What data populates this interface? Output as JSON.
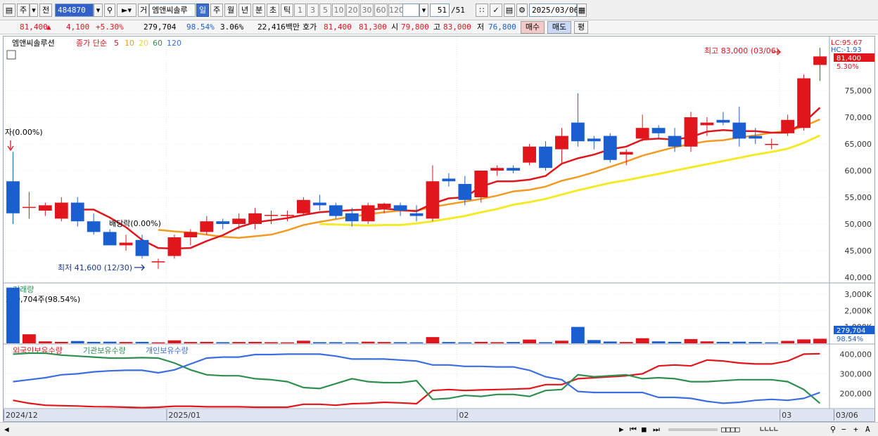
{
  "toolbar": {
    "period_main": "주",
    "prev_label": "전",
    "code": "484870",
    "stock_name": "엠앤씨솔루",
    "periods": [
      "일",
      "주",
      "월",
      "년",
      "분",
      "초",
      "틱"
    ],
    "active_period": "일",
    "steps": [
      "1",
      "3",
      "5",
      "10",
      "20",
      "30",
      "60",
      "120"
    ],
    "count": "51",
    "count_total": "/51",
    "date": "2025/03/06",
    "trade_label": "거"
  },
  "quote": {
    "price": "81,400",
    "arrow": "▲",
    "change": "4,100",
    "change_pct": "+5.30%",
    "volume": "279,704",
    "volume_pct": "98.54%",
    "turnover_pct": "3.06%",
    "amount": "22,416백만",
    "ask_label": "호가",
    "ask": "81,400",
    "bid": "81,300",
    "open_label": "시",
    "open": "79,800",
    "high_label": "고",
    "high": "83,000",
    "low_label": "저",
    "low": "76,800",
    "buy_button": "매수",
    "sell_button": "매도",
    "eval_button": "평"
  },
  "legend": {
    "name": "엠앤씨솔루션",
    "price_label": "종가 단순",
    "ma5": "5",
    "ma10": "10",
    "ma20": "20",
    "ma60": "60",
    "ma120": "120"
  },
  "annotations": {
    "high_note": "최고 83,000 (03/06)",
    "low_note": "최저 41,600 (12/30)",
    "ex_rights": "자(0.00%)",
    "ex_dividend": "배당락(0.00%)",
    "lc_label": "LC:95.67",
    "hc_label": "HC:-1.93",
    "last_price": "81,400",
    "last_pct": "5.30%",
    "volume_title": "거래량",
    "volume_note": "279,704주(98.54%)",
    "volume_last": "279,704",
    "volume_last_pct": "98.54%",
    "holdings_foreign": "외국인보유수량",
    "holdings_inst": "기관보유수량",
    "holdings_indiv": "개인보유수량"
  },
  "axes": {
    "price_ticks": [
      "75,000",
      "70,000",
      "65,000",
      "60,000",
      "55,000",
      "50,000",
      "45,000",
      "40,000"
    ],
    "volume_ticks": [
      "3,000K",
      "2,000K",
      "1,000K"
    ],
    "holdings_ticks": [
      "400,000",
      "300,000",
      "200,000"
    ],
    "x_labels": [
      "2024/12",
      "2025/01",
      "02",
      "03",
      "03/06"
    ]
  },
  "colors": {
    "up": "#e0161c",
    "down": "#1a5fd0",
    "ma5": "#e0161c",
    "ma10": "#f29b22",
    "ma20": "#f4ea2a",
    "foreign_line": "#e0161c",
    "inst_line": "#2f8f4f",
    "indiv_line": "#3b6ee0"
  },
  "chart_data": [
    {
      "type": "candlestick",
      "title": "엠앤씨솔루션",
      "ylim": [
        40000,
        83000
      ],
      "candles": [
        {
          "o": 58000,
          "h": 63500,
          "l": 50000,
          "c": 52000
        },
        {
          "o": 53000,
          "h": 56000,
          "l": 51000,
          "c": 53200
        },
        {
          "o": 52500,
          "h": 54000,
          "l": 51500,
          "c": 53500
        },
        {
          "o": 51000,
          "h": 55000,
          "l": 50500,
          "c": 54000
        },
        {
          "o": 54000,
          "h": 55000,
          "l": 49500,
          "c": 50500
        },
        {
          "o": 50500,
          "h": 52000,
          "l": 48000,
          "c": 48500
        },
        {
          "o": 48500,
          "h": 49000,
          "l": 46000,
          "c": 46000
        },
        {
          "o": 46000,
          "h": 48000,
          "l": 45000,
          "c": 46500
        },
        {
          "o": 47000,
          "h": 48000,
          "l": 43500,
          "c": 44000
        },
        {
          "o": 42800,
          "h": 43500,
          "l": 41600,
          "c": 43000
        },
        {
          "o": 44000,
          "h": 48000,
          "l": 43500,
          "c": 47500
        },
        {
          "o": 47500,
          "h": 49000,
          "l": 46000,
          "c": 48500
        },
        {
          "o": 48500,
          "h": 51500,
          "l": 48000,
          "c": 50500
        },
        {
          "o": 50500,
          "h": 51000,
          "l": 49000,
          "c": 50000
        },
        {
          "o": 50000,
          "h": 52000,
          "l": 49000,
          "c": 51000
        },
        {
          "o": 50000,
          "h": 53000,
          "l": 49000,
          "c": 52000
        },
        {
          "o": 51500,
          "h": 52500,
          "l": 50000,
          "c": 51700
        },
        {
          "o": 51500,
          "h": 52500,
          "l": 50500,
          "c": 51700
        },
        {
          "o": 52000,
          "h": 55000,
          "l": 51500,
          "c": 54500
        },
        {
          "o": 54000,
          "h": 55500,
          "l": 52500,
          "c": 53500
        },
        {
          "o": 53500,
          "h": 54000,
          "l": 51000,
          "c": 51500
        },
        {
          "o": 52000,
          "h": 53000,
          "l": 49500,
          "c": 50500
        },
        {
          "o": 50500,
          "h": 54000,
          "l": 50000,
          "c": 53500
        },
        {
          "o": 53000,
          "h": 54000,
          "l": 52000,
          "c": 53800
        },
        {
          "o": 53500,
          "h": 54000,
          "l": 51500,
          "c": 52500
        },
        {
          "o": 52000,
          "h": 53500,
          "l": 50500,
          "c": 51500
        },
        {
          "o": 51000,
          "h": 61000,
          "l": 50500,
          "c": 58000
        },
        {
          "o": 58500,
          "h": 59500,
          "l": 57000,
          "c": 58000
        },
        {
          "o": 57500,
          "h": 59000,
          "l": 53500,
          "c": 54500
        },
        {
          "o": 55000,
          "h": 60000,
          "l": 54000,
          "c": 60000
        },
        {
          "o": 60000,
          "h": 61000,
          "l": 59000,
          "c": 60500
        },
        {
          "o": 60500,
          "h": 61000,
          "l": 59500,
          "c": 60000
        },
        {
          "o": 61500,
          "h": 65000,
          "l": 61000,
          "c": 64500
        },
        {
          "o": 64500,
          "h": 65500,
          "l": 60000,
          "c": 60500
        },
        {
          "o": 64000,
          "h": 68000,
          "l": 61500,
          "c": 66500
        },
        {
          "o": 69000,
          "h": 74500,
          "l": 64500,
          "c": 65500
        },
        {
          "o": 66000,
          "h": 66500,
          "l": 64000,
          "c": 65500
        },
        {
          "o": 66500,
          "h": 67000,
          "l": 61500,
          "c": 62000
        },
        {
          "o": 63000,
          "h": 64000,
          "l": 61000,
          "c": 63500
        },
        {
          "o": 66000,
          "h": 70500,
          "l": 65500,
          "c": 68000
        },
        {
          "o": 68000,
          "h": 68500,
          "l": 66000,
          "c": 67000
        },
        {
          "o": 66500,
          "h": 68000,
          "l": 63500,
          "c": 64500
        },
        {
          "o": 64500,
          "h": 71000,
          "l": 63500,
          "c": 70000
        },
        {
          "o": 68500,
          "h": 70000,
          "l": 66500,
          "c": 69000
        },
        {
          "o": 69500,
          "h": 71000,
          "l": 68500,
          "c": 69000
        },
        {
          "o": 69000,
          "h": 72000,
          "l": 64500,
          "c": 66000
        },
        {
          "o": 66500,
          "h": 68000,
          "l": 65000,
          "c": 66000
        },
        {
          "o": 65000,
          "h": 66000,
          "l": 64000,
          "c": 65000
        },
        {
          "o": 67000,
          "h": 70500,
          "l": 66500,
          "c": 69500
        },
        {
          "o": 68000,
          "h": 78000,
          "l": 67500,
          "c": 77300
        },
        {
          "o": 79800,
          "h": 83000,
          "l": 76800,
          "c": 81400
        }
      ],
      "ma5": [
        null,
        null,
        null,
        null,
        52700,
        52700,
        51200,
        49400,
        47000,
        45500,
        45400,
        45500,
        46800,
        47900,
        49400,
        50300,
        50700,
        51100,
        51700,
        52200,
        52400,
        52600,
        52700,
        52900,
        52600,
        52400,
        53800,
        54800,
        55000,
        57000,
        58000,
        58000,
        58300,
        59000,
        61300,
        62300,
        63000,
        64000,
        64500,
        65800,
        66000,
        65800,
        66300,
        67300,
        67600,
        67400,
        67400,
        67100,
        67100,
        69000,
        71800
      ],
      "ma10": [
        null,
        null,
        null,
        null,
        null,
        null,
        null,
        null,
        null,
        48900,
        48600,
        48400,
        48000,
        47600,
        47400,
        47700,
        48000,
        48800,
        49800,
        50400,
        50900,
        51400,
        51800,
        52200,
        52500,
        52500,
        53200,
        53700,
        54200,
        54700,
        55300,
        56100,
        56400,
        57000,
        58100,
        58800,
        59700,
        60700,
        61700,
        62800,
        63600,
        64400,
        65000,
        65500,
        65700,
        66200,
        66600,
        67100,
        67400,
        68300,
        69600
      ],
      "ma20": [
        null,
        null,
        null,
        null,
        null,
        null,
        null,
        null,
        null,
        null,
        null,
        null,
        null,
        null,
        null,
        null,
        null,
        null,
        null,
        50000,
        49900,
        49800,
        49700,
        49800,
        49800,
        50100,
        50500,
        51000,
        51500,
        52200,
        52800,
        53600,
        54100,
        54700,
        55500,
        56300,
        57000,
        57700,
        58200,
        58800,
        59400,
        60000,
        60600,
        61200,
        61800,
        62400,
        63000,
        63500,
        64100,
        65200,
        66600
      ]
    },
    {
      "type": "bar",
      "title": "거래량",
      "values": [
        3400000,
        550000,
        120000,
        90000,
        140000,
        90000,
        100000,
        80000,
        90000,
        60000,
        180000,
        80000,
        90000,
        70000,
        80000,
        90000,
        70000,
        60000,
        160000,
        70000,
        70000,
        60000,
        100000,
        80000,
        70000,
        60000,
        380000,
        80000,
        60000,
        90000,
        70000,
        80000,
        230000,
        70000,
        160000,
        1000000,
        200000,
        110000,
        80000,
        310000,
        120000,
        90000,
        260000,
        120000,
        90000,
        100000,
        80000,
        60000,
        150000,
        240000,
        279704
      ],
      "up_days": [
        false,
        true,
        true,
        true,
        false,
        false,
        false,
        true,
        false,
        true,
        true,
        true,
        true,
        false,
        true,
        true,
        true,
        true,
        true,
        false,
        false,
        false,
        true,
        true,
        false,
        false,
        true,
        false,
        false,
        true,
        true,
        false,
        true,
        false,
        true,
        false,
        false,
        false,
        true,
        true,
        false,
        false,
        true,
        true,
        false,
        false,
        false,
        false,
        true,
        true,
        true
      ]
    },
    {
      "type": "line",
      "title": "보유수량",
      "series": [
        {
          "name": "외국인보유수량",
          "values": [
            165000,
            150000,
            140000,
            138000,
            136000,
            133000,
            132000,
            130000,
            128000,
            130000,
            135000,
            135000,
            132000,
            132000,
            132000,
            130000,
            130000,
            130000,
            145000,
            145000,
            140000,
            148000,
            150000,
            155000,
            152000,
            148000,
            215000,
            220000,
            215000,
            218000,
            220000,
            222000,
            225000,
            245000,
            245000,
            275000,
            280000,
            285000,
            290000,
            300000,
            340000,
            345000,
            340000,
            370000,
            365000,
            355000,
            350000,
            350000,
            365000,
            400000,
            402000
          ]
        },
        {
          "name": "기관보유수량",
          "values": [
            400000,
            405000,
            405000,
            395000,
            390000,
            385000,
            380000,
            380000,
            382000,
            380000,
            355000,
            320000,
            295000,
            290000,
            290000,
            275000,
            270000,
            260000,
            230000,
            225000,
            250000,
            275000,
            260000,
            255000,
            255000,
            265000,
            170000,
            175000,
            190000,
            185000,
            195000,
            195000,
            185000,
            215000,
            220000,
            295000,
            285000,
            290000,
            295000,
            275000,
            280000,
            275000,
            260000,
            260000,
            265000,
            270000,
            270000,
            270000,
            260000,
            220000,
            150000
          ]
        },
        {
          "name": "개인보유수량",
          "values": [
            260000,
            270000,
            280000,
            295000,
            300000,
            310000,
            315000,
            318000,
            318000,
            305000,
            320000,
            350000,
            380000,
            385000,
            385000,
            398000,
            398000,
            400000,
            400000,
            400000,
            390000,
            375000,
            375000,
            375000,
            370000,
            365000,
            345000,
            345000,
            338000,
            338000,
            335000,
            335000,
            318000,
            285000,
            270000,
            210000,
            205000,
            205000,
            205000,
            205000,
            180000,
            180000,
            175000,
            160000,
            150000,
            155000,
            165000,
            170000,
            165000,
            175000,
            205000
          ]
        }
      ],
      "ylim": [
        130000,
        430000
      ]
    }
  ]
}
